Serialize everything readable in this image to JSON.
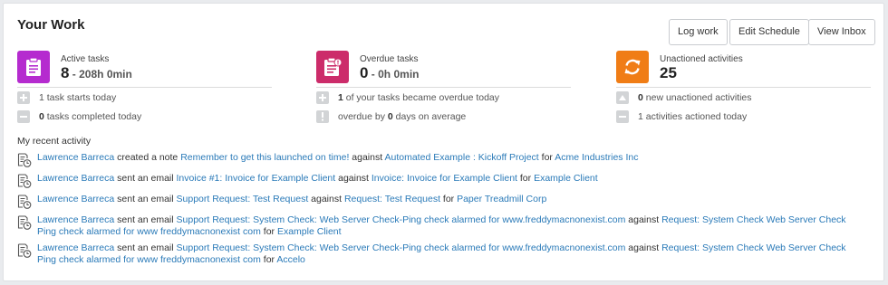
{
  "card": {
    "title": "Your Work"
  },
  "toolbar": {
    "log_work": "Log work",
    "edit_schedule": "Edit Schedule",
    "view_inbox": "View Inbox"
  },
  "colors": {
    "active": "#b52bcf",
    "overdue": "#cc2c6a",
    "unactioned": "#f07d16",
    "link": "#2a7ab8"
  },
  "stats": {
    "active": {
      "label": "Active tasks",
      "count": "8",
      "duration": " - 208h 0min",
      "rows": [
        {
          "pre": "",
          "num": "1 task starts today",
          "post": ""
        },
        {
          "pre": "",
          "num": "0",
          "post": " tasks completed today"
        }
      ]
    },
    "overdue": {
      "label": "Overdue tasks",
      "count": "0",
      "duration": " - 0h 0min",
      "rows": [
        {
          "pre": "",
          "num": "1",
          "post": " of your tasks became overdue today"
        },
        {
          "pre": "overdue by ",
          "num": "0",
          "post": " days on average"
        }
      ]
    },
    "unactioned": {
      "label": "Unactioned activities",
      "count": "25",
      "rows": [
        {
          "pre": "",
          "num": "0",
          "post": " new unactioned activities"
        },
        {
          "pre": "",
          "num": "1",
          "post": " activities actioned today"
        }
      ]
    }
  },
  "recent": {
    "heading": "My recent activity",
    "items": [
      {
        "user": "Lawrence Barreca",
        "verb": " created a note ",
        "subject": "Remember to get this launched on time!",
        "against_word": " against ",
        "target": "Automated Example : Kickoff Project",
        "for_word": " for ",
        "client": "Acme Industries Inc"
      },
      {
        "user": "Lawrence Barreca",
        "verb": " sent an email ",
        "subject": "Invoice #1: Invoice for Example Client",
        "against_word": " against ",
        "target": "Invoice: Invoice for Example Client",
        "for_word": " for ",
        "client": "Example Client"
      },
      {
        "user": "Lawrence Barreca",
        "verb": " sent an email ",
        "subject": "Support Request: Test Request",
        "against_word": " against ",
        "target": "Request: Test Request",
        "for_word": " for ",
        "client": "Paper Treadmill Corp"
      },
      {
        "user": "Lawrence Barreca",
        "verb": " sent an email ",
        "subject": "Support Request: System Check: Web Server Check-Ping check alarmed for www.freddymacnonexist.com",
        "against_word": " against ",
        "target": "Request: System Check Web Server Check Ping check alarmed for www freddymacnonexist com",
        "for_word": " for ",
        "client": "Example Client"
      },
      {
        "user": "Lawrence Barreca",
        "verb": " sent an email ",
        "subject": "Support Request: System Check: Web Server Check-Ping check alarmed for www.freddymacnonexist.com",
        "against_word": " against ",
        "target": "Request: System Check Web Server Check Ping check alarmed for www freddymacnonexist com",
        "for_word": " for ",
        "client": "Accelo"
      }
    ]
  }
}
